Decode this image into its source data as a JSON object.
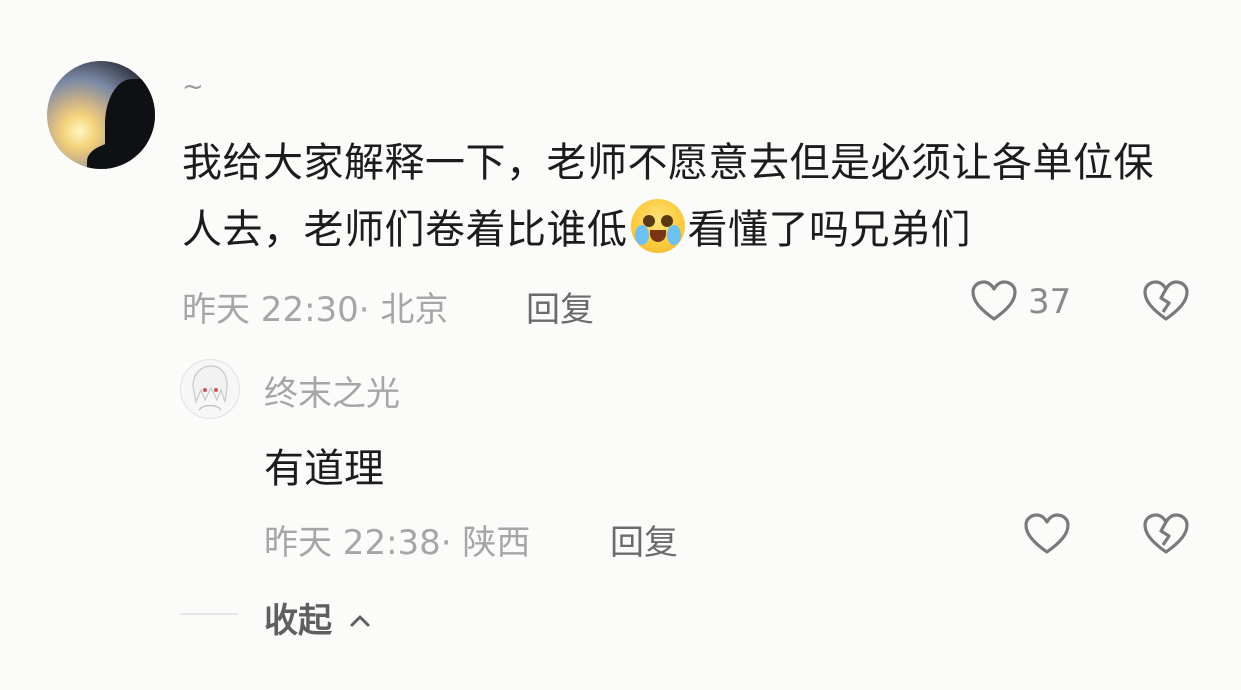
{
  "comment": {
    "username": "~",
    "text_before_emoji": "我给大家解释一下，老师不愿意去但是必须让各单位保人去，老师们卷着比谁低",
    "emoji": "crying-laughing-emoji",
    "text_after_emoji": "看懂了吗兄弟们",
    "time_location": "昨天 22:30· 北京",
    "reply_label": "回复",
    "like_count": "37"
  },
  "reply": {
    "username": "终末之光",
    "text": "有道理",
    "time_location": "昨天 22:38· 陕西",
    "reply_label": "回复"
  },
  "collapse_label": "收起",
  "icons": {
    "like": "heart-outline-icon",
    "dislike": "broken-heart-icon",
    "collapse": "chevron-up-icon"
  },
  "colors": {
    "background": "#fbfbf9",
    "text": "#1c1c1c",
    "meta": "#a6a6a6",
    "icon": "#7a7a7a"
  }
}
